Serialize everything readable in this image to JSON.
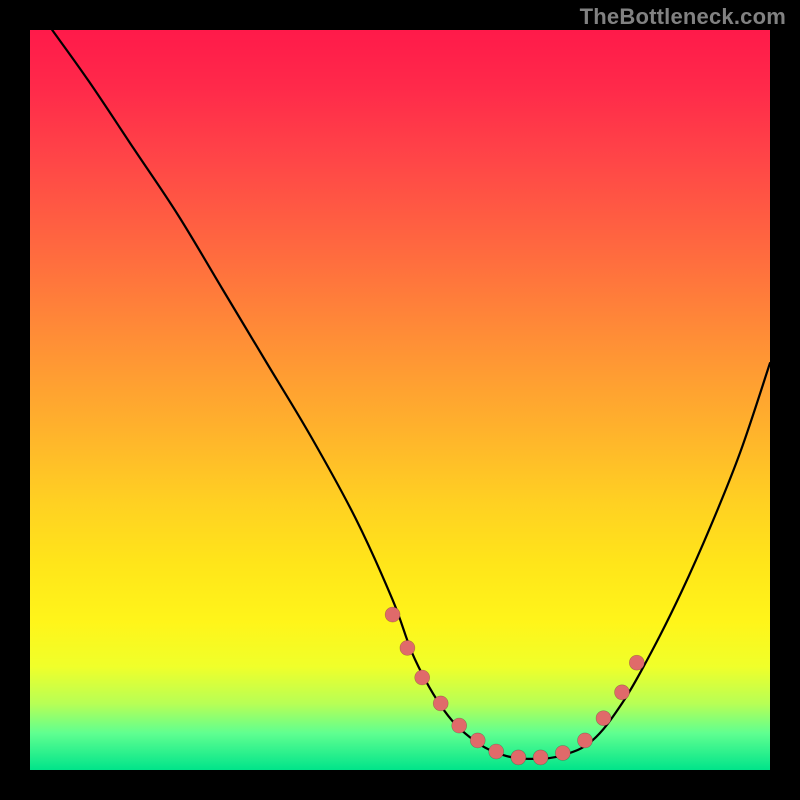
{
  "watermark": "TheBottleneck.com",
  "colors": {
    "background": "#000000",
    "curve": "#000000",
    "dot_fill": "#e06a6a"
  },
  "chart_data": {
    "type": "line",
    "title": "",
    "xlabel": "",
    "ylabel": "",
    "xlim": [
      0,
      100
    ],
    "ylim": [
      0,
      100
    ],
    "curve": {
      "x": [
        3,
        8,
        14,
        20,
        26,
        32,
        38,
        44,
        49,
        52,
        56,
        60,
        64,
        68,
        72,
        76,
        80,
        84,
        88,
        92,
        96,
        100
      ],
      "y": [
        100,
        93,
        84,
        75,
        65,
        55,
        45,
        34,
        23,
        15,
        8,
        4,
        2,
        1.5,
        2,
        4,
        9,
        16,
        24,
        33,
        43,
        55
      ]
    },
    "series": [
      {
        "name": "markers",
        "x": [
          49.0,
          51.0,
          53.0,
          55.5,
          58.0,
          60.5,
          63.0,
          66.0,
          69.0,
          72.0,
          75.0,
          77.5,
          80.0,
          82.0
        ],
        "y": [
          21.0,
          16.5,
          12.5,
          9.0,
          6.0,
          4.0,
          2.5,
          1.7,
          1.7,
          2.3,
          4.0,
          7.0,
          10.5,
          14.5
        ]
      }
    ],
    "grid": false,
    "legend": false
  }
}
